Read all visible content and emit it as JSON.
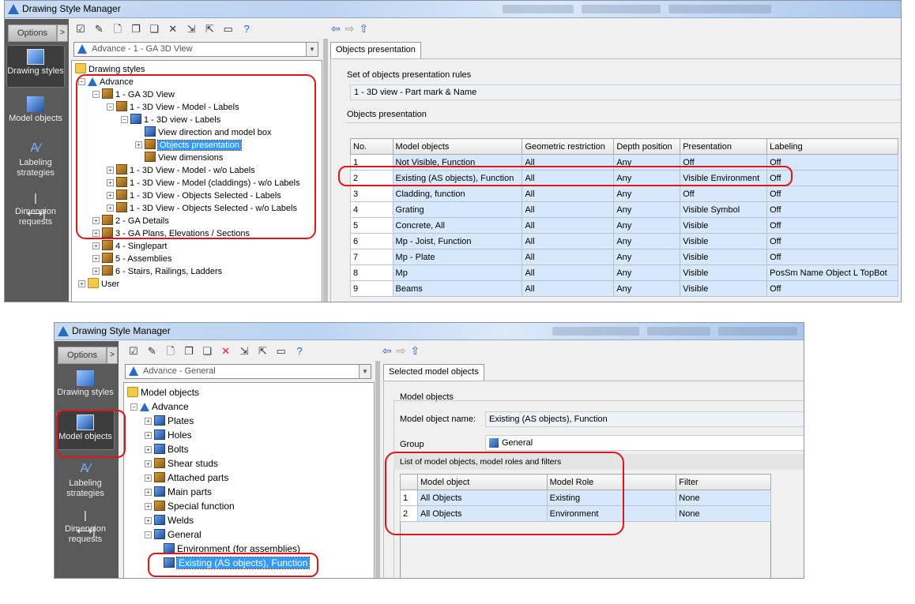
{
  "top_window": {
    "title": "Drawing Style Manager",
    "options_label": "Options",
    "options_arrow": ">",
    "nav": [
      {
        "label": "Drawing styles",
        "icon": "drawing-styles-icon",
        "selected": true
      },
      {
        "label": "Model objects",
        "icon": "model-objects-icon",
        "selected": false
      },
      {
        "label": "Labeling strategies",
        "icon": "labeling-strategies-icon",
        "selected": false
      },
      {
        "label": "Dimension requests",
        "icon": "dimension-requests-icon",
        "selected": false
      }
    ],
    "combo_value": "Advance - 1 - GA 3D View",
    "tree": [
      {
        "label": "Drawing styles"
      },
      {
        "label": "Advance"
      },
      {
        "label": "1 - GA 3D View"
      },
      {
        "label": "1 - 3D View - Model - Labels"
      },
      {
        "label": "1 - 3D view - Labels"
      },
      {
        "label": "View direction and model box"
      },
      {
        "label": "Objects presentation"
      },
      {
        "label": "View dimensions"
      },
      {
        "label": "1 - 3D View - Model - w/o Labels"
      },
      {
        "label": "1 - 3D View - Model (claddings) - w/o Labels"
      },
      {
        "label": "1 - 3D View - Objects Selected - Labels"
      },
      {
        "label": "1 - 3D View - Objects Selected - w/o Labels"
      },
      {
        "label": "2 - GA Details"
      },
      {
        "label": "3 - GA Plans, Elevations / Sections"
      },
      {
        "label": "4 - Singlepart"
      },
      {
        "label": "5 - Assemblies"
      },
      {
        "label": "6 - Stairs, Railings, Ladders"
      },
      {
        "label": "User"
      }
    ],
    "tab": "Objects presentation",
    "rules_label": "Set of objects presentation rules",
    "rules_value": "1 - 3D view - Part mark & Name",
    "group_label": "Objects presentation",
    "columns": [
      "No.",
      "Model objects",
      "Geometric restriction",
      "Depth position",
      "Presentation",
      "Labeling"
    ],
    "rows": [
      [
        "1",
        "Not Visible, Function",
        "All",
        "Any",
        "Off",
        "Off"
      ],
      [
        "2",
        "Existing (AS objects), Function",
        "All",
        "Any",
        "Visible Environment",
        "Off"
      ],
      [
        "3",
        "Cladding, function",
        "All",
        "Any",
        "Off",
        "Off"
      ],
      [
        "4",
        "Grating",
        "All",
        "Any",
        "Visible Symbol",
        "Off"
      ],
      [
        "5",
        "Concrete, All",
        "All",
        "Any",
        "Visible",
        "Off"
      ],
      [
        "6",
        "Mp - Joist, Function",
        "All",
        "Any",
        "Visible",
        "Off"
      ],
      [
        "7",
        "Mp - Plate",
        "All",
        "Any",
        "Visible",
        "Off"
      ],
      [
        "8",
        "Mp",
        "All",
        "Any",
        "Visible",
        "PosSm Name Object L TopBot"
      ],
      [
        "9",
        "Beams",
        "All",
        "Any",
        "Visible",
        "Off"
      ]
    ]
  },
  "bottom_window": {
    "title": "Drawing Style Manager",
    "options_label": "Options",
    "options_arrow": ">",
    "nav": [
      {
        "label": "Drawing styles",
        "icon": "drawing-styles-icon",
        "selected": false
      },
      {
        "label": "Model objects",
        "icon": "model-objects-icon",
        "selected": true
      },
      {
        "label": "Labeling strategies",
        "icon": "labeling-strategies-icon",
        "selected": false
      },
      {
        "label": "Dimension requests",
        "icon": "dimension-requests-icon",
        "selected": false
      }
    ],
    "combo_value": "Advance - General",
    "tree": [
      {
        "label": "Model objects"
      },
      {
        "label": "Advance"
      },
      {
        "label": "Plates"
      },
      {
        "label": "Holes"
      },
      {
        "label": "Bolts"
      },
      {
        "label": "Shear studs"
      },
      {
        "label": "Attached parts"
      },
      {
        "label": "Main parts"
      },
      {
        "label": "Special function"
      },
      {
        "label": "Welds"
      },
      {
        "label": "General"
      },
      {
        "label": "Environment (for assemblies)"
      },
      {
        "label": "Existing (AS objects), Function"
      }
    ],
    "tab": "Selected model objects",
    "group_label": "Model objects",
    "name_label": "Model object name:",
    "name_value": "Existing (AS objects), Function",
    "grp_label": "Group",
    "grp_value": "General",
    "list_label": "List of model objects, model roles and filters",
    "columns": [
      "Model object",
      "Model Role",
      "Filter"
    ],
    "rows": [
      [
        "1",
        "All Objects",
        "Existing",
        "None"
      ],
      [
        "2",
        "All Objects",
        "Environment",
        "None"
      ]
    ]
  },
  "colors": {
    "highlight": "#3399ff",
    "annotation": "#e0151b",
    "grid_cell": "#d6e8fa"
  }
}
